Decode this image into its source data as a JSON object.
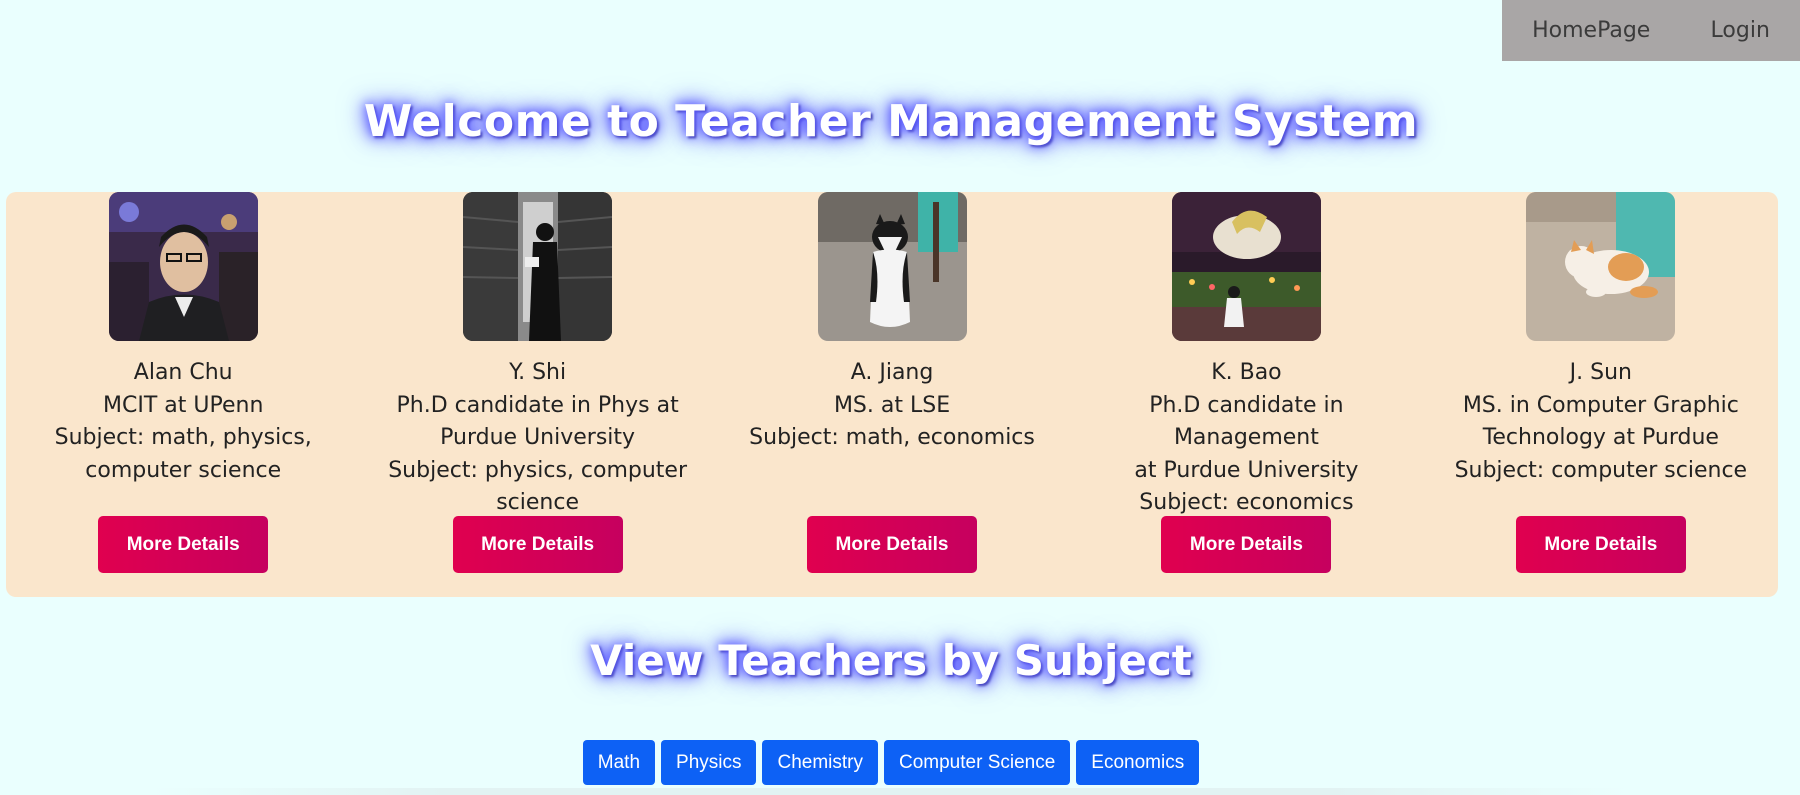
{
  "nav": {
    "home": "HomePage",
    "login": "Login"
  },
  "page_title": "Welcome to Teacher Management System",
  "teachers": [
    {
      "name": "Alan Chu",
      "lines": [
        "MCIT at UPenn",
        "Subject: math, physics,",
        "computer science"
      ],
      "button": "More Details"
    },
    {
      "name": "Y. Shi",
      "lines": [
        "Ph.D candidate in Phys at",
        "Purdue University",
        "Subject: physics, computer",
        "science"
      ],
      "button": "More Details"
    },
    {
      "name": "A. Jiang",
      "lines": [
        "MS. at LSE",
        "Subject: math, economics"
      ],
      "button": "More Details"
    },
    {
      "name": "K. Bao",
      "lines": [
        "Ph.D candidate in Management",
        "at Purdue University",
        "Subject: economics"
      ],
      "button": "More Details"
    },
    {
      "name": "J. Sun",
      "lines": [
        "MS. in Computer Graphic",
        "Technology at Purdue",
        "Subject: computer science"
      ],
      "button": "More Details"
    }
  ],
  "subject_section_title": "View Teachers by Subject",
  "subjects": [
    "Math",
    "Physics",
    "Chemistry",
    "Computer Science",
    "Economics"
  ],
  "colors": {
    "background": "#eafffe",
    "panel": "#fae6cc",
    "nav": "#a9a6a6",
    "detail_button": "#d6004f",
    "subject_button": "#0d61f5"
  }
}
